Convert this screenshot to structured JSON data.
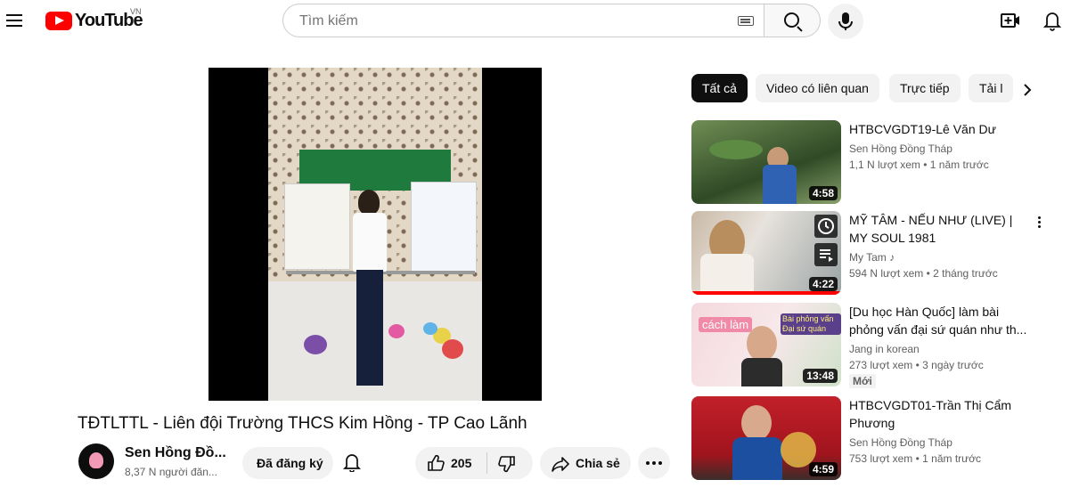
{
  "header": {
    "logo_text": "YouTube",
    "region": "VN",
    "search_placeholder": "Tìm kiếm"
  },
  "video": {
    "title": "TĐTLTTL - Liên đội Trường THCS Kim Hồng - TP Cao Lãnh",
    "channel_name": "Sen Hồng Đồ...",
    "subscribers": "8,37 N người đăn...",
    "subscribed_label": "Đã đăng ký",
    "like_count": "205",
    "share_label": "Chia sẻ"
  },
  "chips": [
    "Tất cả",
    "Video có liên quan",
    "Trực tiếp",
    "Tải l"
  ],
  "recommendations": [
    {
      "title": "HTBCVGDT19-Lê Văn Dư",
      "channel": "Sen Hồng Đồng Tháp",
      "views": "1,1 N lượt xem",
      "age": "1 năm trước",
      "duration": "4:58"
    },
    {
      "title": "MỸ TÂM - NẾU NHƯ (LIVE) | MY SOUL 1981",
      "channel": "My Tam",
      "views": "594 N lượt xem",
      "age": "2 tháng trước",
      "duration": "4:22"
    },
    {
      "title": "[Du học Hàn Quốc] làm bài phỏng vấn đại sứ quán như th...",
      "channel": "Jang in korean",
      "views": "273 lượt xem",
      "age": "3 ngày trước",
      "duration": "13:48",
      "badge": "Mới",
      "thumb_text_1": "cách làm",
      "thumb_text_2": "Bài phỏng vấn Đại sứ quán"
    },
    {
      "title": "HTBCVGDT01-Trần Thị Cẩm Phương",
      "channel": "Sen Hồng Đồng Tháp",
      "views": "753 lượt xem",
      "age": "1 năm trước",
      "duration": "4:59"
    }
  ],
  "colors": {
    "brand_red": "#ff0000",
    "text": "#0f0f0f",
    "muted": "#606060",
    "chip_bg": "#f2f2f2"
  }
}
